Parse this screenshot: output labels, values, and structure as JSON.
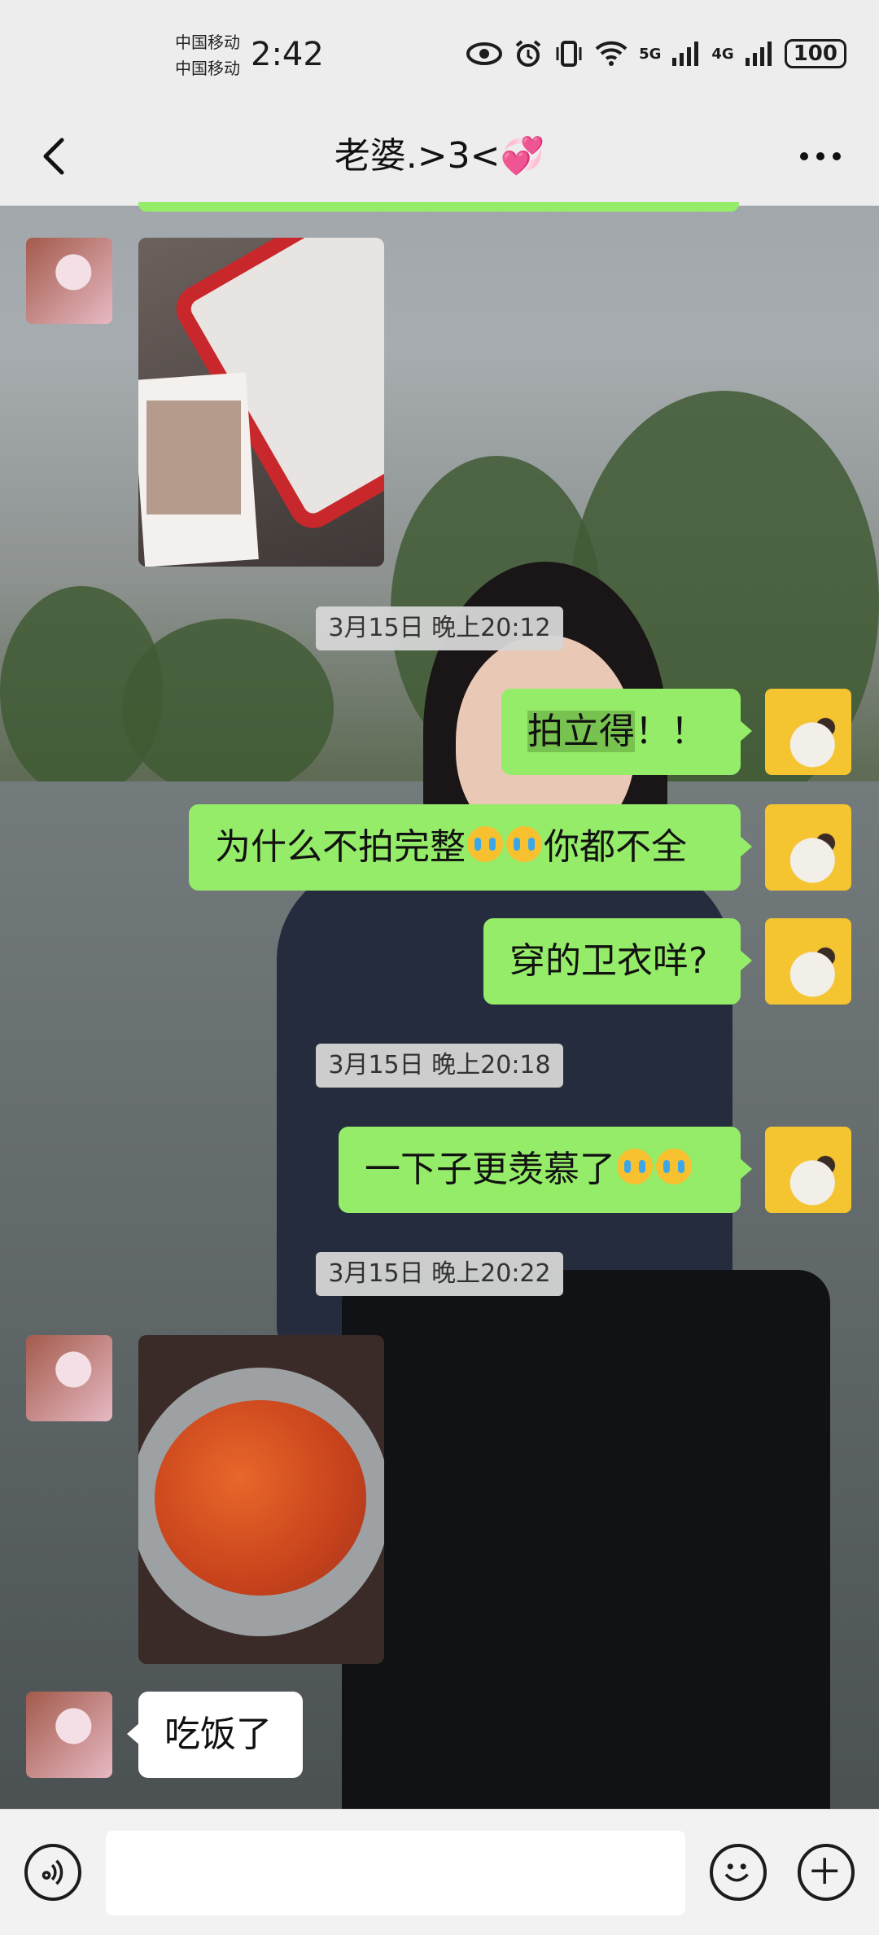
{
  "status_bar": {
    "carrier_1": "中国移动",
    "carrier_2": "中国移动",
    "time": "2:42",
    "net_1": "5G",
    "net_2": "4G",
    "battery": "100"
  },
  "header": {
    "title": "老婆.>3<💞"
  },
  "messages": [
    {
      "type": "image",
      "side": "her",
      "description": "photo"
    },
    {
      "type": "timestamp",
      "text": "3月15日 晚上20:12"
    },
    {
      "type": "text",
      "side": "me",
      "text_highlight": "拍立得",
      "text_rest": "！！"
    },
    {
      "type": "text",
      "side": "me",
      "text_a": "为什么不拍完整",
      "text_b": "你都不全"
    },
    {
      "type": "text",
      "side": "me",
      "text": "穿的卫衣咩?"
    },
    {
      "type": "timestamp",
      "text": "3月15日 晚上20:18"
    },
    {
      "type": "text",
      "side": "me",
      "text_a": "一下子更羡慕了"
    },
    {
      "type": "timestamp",
      "text": "3月15日 晚上20:22"
    },
    {
      "type": "image",
      "side": "her",
      "description": "photo"
    },
    {
      "type": "text",
      "side": "her",
      "text": "吃饭了"
    }
  ],
  "colors": {
    "my_bubble": "#95ec69",
    "her_bubble": "#ffffff",
    "bar_bg": "#ededed"
  },
  "icons": [
    "back-arrow-icon",
    "more-icon",
    "voice-icon",
    "emoji-icon",
    "add-icon"
  ]
}
